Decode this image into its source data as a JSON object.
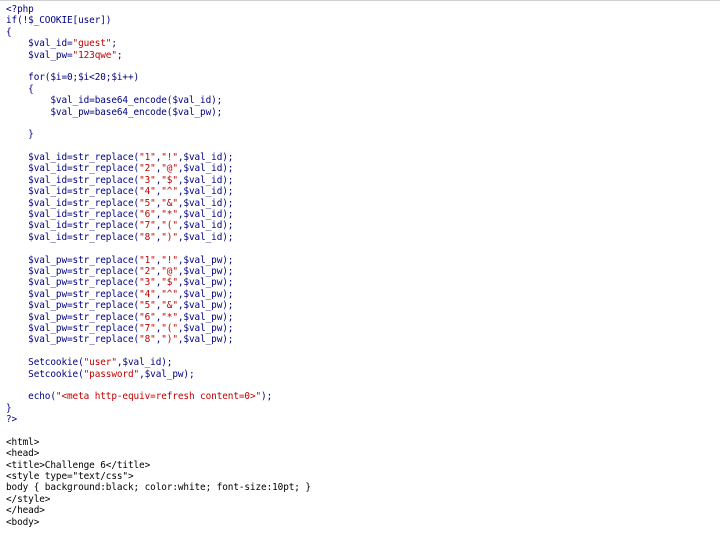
{
  "colors": {
    "php_text": "#000080",
    "string_text": "#c00000",
    "html_text": "#000000",
    "background": "#ffffff"
  },
  "code_lines": [
    [
      {
        "t": "<?php",
        "c": "plain"
      }
    ],
    [
      {
        "t": "if(!$_COOKIE[user])",
        "c": "plain"
      }
    ],
    [
      {
        "t": "{",
        "c": "plain"
      }
    ],
    [
      {
        "t": "    $val_id=",
        "c": "plain"
      },
      {
        "t": "\"guest\"",
        "c": "str"
      },
      {
        "t": ";",
        "c": "plain"
      }
    ],
    [
      {
        "t": "    $val_pw=",
        "c": "plain"
      },
      {
        "t": "\"123qwe\"",
        "c": "str"
      },
      {
        "t": ";",
        "c": "plain"
      }
    ],
    [
      {
        "t": "",
        "c": "plain"
      }
    ],
    [
      {
        "t": "    for($i=0;$i<20;$i++)",
        "c": "plain"
      }
    ],
    [
      {
        "t": "    {",
        "c": "plain"
      }
    ],
    [
      {
        "t": "        $val_id=base64_encode($val_id);",
        "c": "plain"
      }
    ],
    [
      {
        "t": "        $val_pw=base64_encode($val_pw);",
        "c": "plain"
      }
    ],
    [
      {
        "t": "",
        "c": "plain"
      }
    ],
    [
      {
        "t": "    }",
        "c": "plain"
      }
    ],
    [
      {
        "t": "",
        "c": "plain"
      }
    ],
    [
      {
        "t": "    $val_id=str_replace(",
        "c": "plain"
      },
      {
        "t": "\"1\"",
        "c": "str"
      },
      {
        "t": ",",
        "c": "plain"
      },
      {
        "t": "\"!\"",
        "c": "str"
      },
      {
        "t": ",$val_id);",
        "c": "plain"
      }
    ],
    [
      {
        "t": "    $val_id=str_replace(",
        "c": "plain"
      },
      {
        "t": "\"2\"",
        "c": "str"
      },
      {
        "t": ",",
        "c": "plain"
      },
      {
        "t": "\"@\"",
        "c": "str"
      },
      {
        "t": ",$val_id);",
        "c": "plain"
      }
    ],
    [
      {
        "t": "    $val_id=str_replace(",
        "c": "plain"
      },
      {
        "t": "\"3\"",
        "c": "str"
      },
      {
        "t": ",",
        "c": "plain"
      },
      {
        "t": "\"$\"",
        "c": "str"
      },
      {
        "t": ",$val_id);",
        "c": "plain"
      }
    ],
    [
      {
        "t": "    $val_id=str_replace(",
        "c": "plain"
      },
      {
        "t": "\"4\"",
        "c": "str"
      },
      {
        "t": ",",
        "c": "plain"
      },
      {
        "t": "\"^\"",
        "c": "str"
      },
      {
        "t": ",$val_id);",
        "c": "plain"
      }
    ],
    [
      {
        "t": "    $val_id=str_replace(",
        "c": "plain"
      },
      {
        "t": "\"5\"",
        "c": "str"
      },
      {
        "t": ",",
        "c": "plain"
      },
      {
        "t": "\"&\"",
        "c": "str"
      },
      {
        "t": ",$val_id);",
        "c": "plain"
      }
    ],
    [
      {
        "t": "    $val_id=str_replace(",
        "c": "plain"
      },
      {
        "t": "\"6\"",
        "c": "str"
      },
      {
        "t": ",",
        "c": "plain"
      },
      {
        "t": "\"*\"",
        "c": "str"
      },
      {
        "t": ",$val_id);",
        "c": "plain"
      }
    ],
    [
      {
        "t": "    $val_id=str_replace(",
        "c": "plain"
      },
      {
        "t": "\"7\"",
        "c": "str"
      },
      {
        "t": ",",
        "c": "plain"
      },
      {
        "t": "\"(\"",
        "c": "str"
      },
      {
        "t": ",$val_id);",
        "c": "plain"
      }
    ],
    [
      {
        "t": "    $val_id=str_replace(",
        "c": "plain"
      },
      {
        "t": "\"8\"",
        "c": "str"
      },
      {
        "t": ",",
        "c": "plain"
      },
      {
        "t": "\")\"",
        "c": "str"
      },
      {
        "t": ",$val_id);",
        "c": "plain"
      }
    ],
    [
      {
        "t": "",
        "c": "plain"
      }
    ],
    [
      {
        "t": "    $val_pw=str_replace(",
        "c": "plain"
      },
      {
        "t": "\"1\"",
        "c": "str"
      },
      {
        "t": ",",
        "c": "plain"
      },
      {
        "t": "\"!\"",
        "c": "str"
      },
      {
        "t": ",$val_pw);",
        "c": "plain"
      }
    ],
    [
      {
        "t": "    $val_pw=str_replace(",
        "c": "plain"
      },
      {
        "t": "\"2\"",
        "c": "str"
      },
      {
        "t": ",",
        "c": "plain"
      },
      {
        "t": "\"@\"",
        "c": "str"
      },
      {
        "t": ",$val_pw);",
        "c": "plain"
      }
    ],
    [
      {
        "t": "    $val_pw=str_replace(",
        "c": "plain"
      },
      {
        "t": "\"3\"",
        "c": "str"
      },
      {
        "t": ",",
        "c": "plain"
      },
      {
        "t": "\"$\"",
        "c": "str"
      },
      {
        "t": ",$val_pw);",
        "c": "plain"
      }
    ],
    [
      {
        "t": "    $val_pw=str_replace(",
        "c": "plain"
      },
      {
        "t": "\"4\"",
        "c": "str"
      },
      {
        "t": ",",
        "c": "plain"
      },
      {
        "t": "\"^\"",
        "c": "str"
      },
      {
        "t": ",$val_pw);",
        "c": "plain"
      }
    ],
    [
      {
        "t": "    $val_pw=str_replace(",
        "c": "plain"
      },
      {
        "t": "\"5\"",
        "c": "str"
      },
      {
        "t": ",",
        "c": "plain"
      },
      {
        "t": "\"&\"",
        "c": "str"
      },
      {
        "t": ",$val_pw);",
        "c": "plain"
      }
    ],
    [
      {
        "t": "    $val_pw=str_replace(",
        "c": "plain"
      },
      {
        "t": "\"6\"",
        "c": "str"
      },
      {
        "t": ",",
        "c": "plain"
      },
      {
        "t": "\"*\"",
        "c": "str"
      },
      {
        "t": ",$val_pw);",
        "c": "plain"
      }
    ],
    [
      {
        "t": "    $val_pw=str_replace(",
        "c": "plain"
      },
      {
        "t": "\"7\"",
        "c": "str"
      },
      {
        "t": ",",
        "c": "plain"
      },
      {
        "t": "\"(\"",
        "c": "str"
      },
      {
        "t": ",$val_pw);",
        "c": "plain"
      }
    ],
    [
      {
        "t": "    $val_pw=str_replace(",
        "c": "plain"
      },
      {
        "t": "\"8\"",
        "c": "str"
      },
      {
        "t": ",",
        "c": "plain"
      },
      {
        "t": "\")\"",
        "c": "str"
      },
      {
        "t": ",$val_pw);",
        "c": "plain"
      }
    ],
    [
      {
        "t": "",
        "c": "plain"
      }
    ],
    [
      {
        "t": "    Setcookie(",
        "c": "plain"
      },
      {
        "t": "\"user\"",
        "c": "str"
      },
      {
        "t": ",$val_id);",
        "c": "plain"
      }
    ],
    [
      {
        "t": "    Setcookie(",
        "c": "plain"
      },
      {
        "t": "\"password\"",
        "c": "str"
      },
      {
        "t": ",$val_pw);",
        "c": "plain"
      }
    ],
    [
      {
        "t": "",
        "c": "plain"
      }
    ],
    [
      {
        "t": "    echo(",
        "c": "plain"
      },
      {
        "t": "\"<meta http-equiv=refresh content=0>\"",
        "c": "str"
      },
      {
        "t": ");",
        "c": "plain"
      }
    ],
    [
      {
        "t": "}",
        "c": "plain"
      }
    ],
    [
      {
        "t": "?>",
        "c": "plain"
      }
    ],
    [
      {
        "t": "",
        "c": "plain"
      }
    ],
    [
      {
        "t": "<html>",
        "c": "html"
      }
    ],
    [
      {
        "t": "<head>",
        "c": "html"
      }
    ],
    [
      {
        "t": "<title>Challenge 6</title>",
        "c": "html"
      }
    ],
    [
      {
        "t": "<style type=\"text/css\">",
        "c": "html"
      }
    ],
    [
      {
        "t": "body { background:black; color:white; font-size:10pt; }",
        "c": "html"
      }
    ],
    [
      {
        "t": "</style>",
        "c": "html"
      }
    ],
    [
      {
        "t": "</head>",
        "c": "html"
      }
    ],
    [
      {
        "t": "<body>",
        "c": "html"
      }
    ]
  ]
}
